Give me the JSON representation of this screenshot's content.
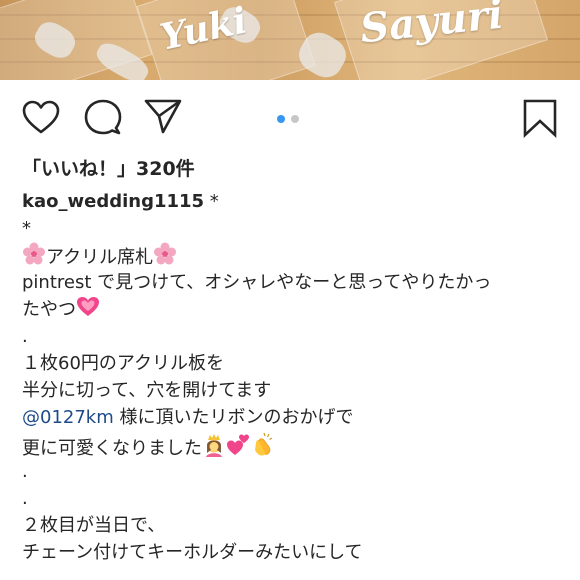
{
  "post": {
    "image_names": [
      "Yuki",
      "Sayuri"
    ],
    "carousel": {
      "count": 2,
      "active_index": 0,
      "active_color": "#3897f0",
      "inactive_color": "#c7c7c7"
    }
  },
  "actions": {
    "like_icon": "heart-icon",
    "comment_icon": "comment-icon",
    "share_icon": "paper-plane-icon",
    "save_icon": "bookmark-icon"
  },
  "likes_text": "「いいね！」320件",
  "caption": {
    "username": "kao_wedding1115",
    "after_username": " *",
    "line2": "*",
    "line3": "アクリル席札",
    "line4": "pintrest で見つけて、オシャレやなーと思ってやりたかっ",
    "line5": "たやつ",
    "line6": ".",
    "line7": "１枚60円のアクリル板を",
    "line8": "半分に切って、穴を開けてます",
    "line9_mention": "@0127km",
    "line9_rest": " 様に頂いたリボンのおかげで",
    "line10": "更に可愛くなりました",
    "line11": ".",
    "line12": ".",
    "line13": "２枚目が当日で、",
    "line14": "チェーン付けてキーホルダーみたいにして"
  },
  "colors": {
    "text": "#262626",
    "mention": "#1f4a8a"
  }
}
